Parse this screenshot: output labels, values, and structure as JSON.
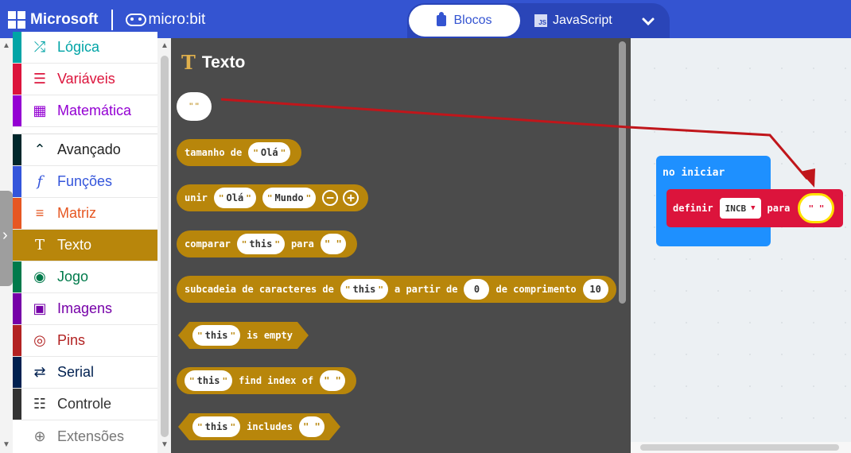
{
  "header": {
    "brand": "Microsoft",
    "product": "micro:bit",
    "tabs": [
      {
        "label": "Blocos",
        "active": true
      },
      {
        "label": "JavaScript",
        "active": false
      }
    ],
    "js_badge": "JS"
  },
  "sidebar": {
    "items": [
      {
        "label": "Lógica",
        "icon": "shuffle-icon",
        "color": "#00a4a6"
      },
      {
        "label": "Variáveis",
        "icon": "list-icon",
        "color": "#dc143c"
      },
      {
        "label": "Matemática",
        "icon": "calculator-icon",
        "color": "#9400d3"
      },
      {
        "label": "Avançado",
        "icon": "chevron-up-icon",
        "color": "#00272b"
      },
      {
        "label": "Funções",
        "icon": "function-icon",
        "color": "#3455db"
      },
      {
        "label": "Matriz",
        "icon": "ordered-list-icon",
        "color": "#e65722"
      },
      {
        "label": "Texto",
        "icon": "text-icon",
        "color": "#b8860b",
        "selected": true
      },
      {
        "label": "Jogo",
        "icon": "gamepad-icon",
        "color": "#007a4b"
      },
      {
        "label": "Imagens",
        "icon": "image-icon",
        "color": "#7600a8"
      },
      {
        "label": "Pins",
        "icon": "target-icon",
        "color": "#b22222"
      },
      {
        "label": "Serial",
        "icon": "usb-icon",
        "color": "#002050"
      },
      {
        "label": "Controle",
        "icon": "server-icon",
        "color": "#333333"
      },
      {
        "label": "Extensões",
        "icon": "plus-circle-icon",
        "color": "#999999"
      }
    ]
  },
  "flyout": {
    "title": "Texto",
    "title_icon": "T",
    "empty_string": "\" \"",
    "blocks": {
      "length": {
        "word": "tamanho de",
        "arg": "Olá"
      },
      "join": {
        "word": "unir",
        "arg1": "Olá",
        "arg2": "Mundo",
        "minus": "−",
        "plus": "+"
      },
      "compare": {
        "word": "comparar",
        "arg": "this",
        "word2": "para",
        "arg2": "\" \""
      },
      "substring": {
        "word": "subcadeia de caracteres de",
        "arg": "this",
        "word2": "a partir de",
        "n1": "0",
        "word3": "de comprimento",
        "n2": "10"
      },
      "is_empty": {
        "arg": "this",
        "word": "is empty"
      },
      "find_index": {
        "arg": "this",
        "word": "find index of",
        "arg2": "\" \""
      },
      "includes": {
        "arg": "this",
        "word": "includes",
        "arg2": "\" \""
      }
    }
  },
  "workspace": {
    "on_start": "no iniciar",
    "set_block": {
      "word": "definir",
      "variable": "INCB",
      "word2": "para",
      "value": "\" \""
    }
  },
  "colors": {
    "header": "#3454d1",
    "text_category": "#b8860b",
    "flyout_bg": "#4b4b4b",
    "on_start": "#1e90ff",
    "variables": "#dc143c",
    "annotation_arrow": "#c0161b"
  }
}
